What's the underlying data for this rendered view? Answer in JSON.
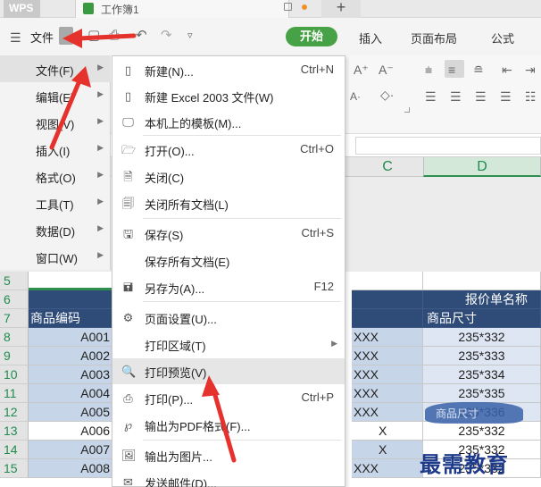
{
  "titlebar": {
    "app_name": "WPS",
    "doc_title": "工作簿1",
    "new_tab_symbol": "+"
  },
  "ribbon": {
    "menu_icon": "hamburger-icon",
    "file_label": "文件",
    "tabs": [
      "开始",
      "插入",
      "页面布局",
      "公式"
    ],
    "active_tab": "开始",
    "active_color": "#47a247"
  },
  "toolbar": {
    "font_grow": "A⁺",
    "font_shrink": "A⁻"
  },
  "columns": {
    "c": "C",
    "d": "D"
  },
  "submenu": {
    "items": [
      {
        "label": "文件(F)",
        "active": true
      },
      {
        "label": "编辑(E)"
      },
      {
        "label": "视图(V)"
      },
      {
        "label": "插入(I)"
      },
      {
        "label": "格式(O)"
      },
      {
        "label": "工具(T)"
      },
      {
        "label": "数据(D)"
      },
      {
        "label": "窗口(W)"
      }
    ]
  },
  "file_dropdown": {
    "items": [
      {
        "icon": "new-file-icon",
        "label": "新建(N)...",
        "shortcut": "Ctrl+N"
      },
      {
        "icon": "new-file-icon",
        "label": "新建 Excel 2003 文件(W)",
        "shortcut": ""
      },
      {
        "icon": "monitor-template-icon",
        "label": "本机上的模板(M)...",
        "shortcut": ""
      },
      {
        "icon": "open-folder-icon",
        "label": "打开(O)...",
        "shortcut": "Ctrl+O"
      },
      {
        "icon": "close-doc-icon",
        "label": "关闭(C)",
        "shortcut": ""
      },
      {
        "icon": "close-all-icon",
        "label": "关闭所有文档(L)",
        "shortcut": ""
      },
      {
        "icon": "save-icon",
        "label": "保存(S)",
        "shortcut": "Ctrl+S"
      },
      {
        "icon": "",
        "label": "保存所有文档(E)",
        "shortcut": ""
      },
      {
        "icon": "save-as-icon",
        "label": "另存为(A)...",
        "shortcut": "F12"
      },
      {
        "icon": "page-setup-icon",
        "label": "页面设置(U)...",
        "shortcut": ""
      },
      {
        "icon": "",
        "label": "打印区域(T)",
        "shortcut": "",
        "submenu": true
      },
      {
        "icon": "print-preview-icon",
        "label": "打印预览(V)",
        "shortcut": "",
        "hover": true
      },
      {
        "icon": "printer-icon",
        "label": "打印(P)...",
        "shortcut": "Ctrl+P"
      },
      {
        "icon": "pdf-export-icon",
        "label": "输出为PDF格式(F)...",
        "shortcut": ""
      },
      {
        "icon": "image-export-icon",
        "label": "输出为图片...",
        "shortcut": ""
      },
      {
        "icon": "mail-icon",
        "label": "发送邮件(D)...",
        "shortcut": ""
      }
    ]
  },
  "sheet": {
    "rows": [
      {
        "num": "5",
        "a": "",
        "c": "",
        "d": "",
        "style": "blank"
      },
      {
        "num": "6",
        "a": "",
        "c": "",
        "d": "报价单名称",
        "style": "dark"
      },
      {
        "num": "7",
        "a": "商品编码",
        "c": "",
        "d": "商品尺寸",
        "style": "dark"
      },
      {
        "num": "8",
        "a": "A001",
        "c": "XXX",
        "d": "235*332",
        "style": "alt"
      },
      {
        "num": "9",
        "a": "A002",
        "c": "XXX",
        "d": "235*333",
        "style": "alt"
      },
      {
        "num": "10",
        "a": "A003",
        "c": "XXX",
        "d": "235*334",
        "style": "alt"
      },
      {
        "num": "11",
        "a": "A004",
        "c": "XXX",
        "d": "235*335",
        "style": "alt"
      },
      {
        "num": "12",
        "a": "A005",
        "c": "XXX",
        "d": "235*336",
        "style": "alt"
      },
      {
        "num": "13",
        "a": "A006",
        "c": "X",
        "d": "235*332",
        "style": "wht"
      },
      {
        "num": "14",
        "a": "A007",
        "c": "X",
        "d": "235*332",
        "style": "alt"
      },
      {
        "num": "15",
        "a": "A008",
        "c": "XXX",
        "d": "235*332",
        "style": "alt"
      }
    ],
    "overlay_text": "商品尺寸"
  },
  "watermark": "最需教育",
  "annotation_color": "#e5322d"
}
